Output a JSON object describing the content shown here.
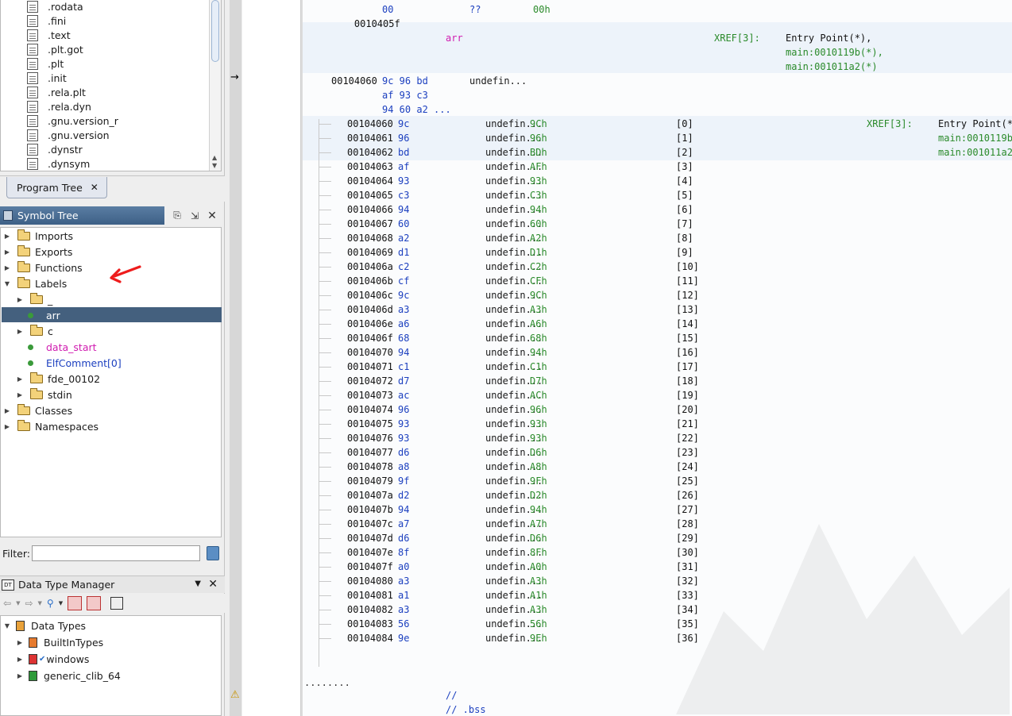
{
  "program_tree": {
    "items": [
      ".rodata",
      ".fini",
      ".text",
      ".plt.got",
      ".plt",
      ".init",
      ".rela.plt",
      ".rela.dyn",
      ".gnu.version_r",
      ".gnu.version",
      ".dynstr",
      ".dynsym"
    ],
    "tab_label": "Program Tree"
  },
  "symbol_tree": {
    "title": "Symbol Tree",
    "nodes": {
      "imports": "Imports",
      "exports": "Exports",
      "functions": "Functions",
      "labels": "Labels",
      "underscore": "_",
      "arr": "arr",
      "c": "c",
      "data_start": "data_start",
      "elfcomment": "ElfComment[0]",
      "fde": "fde_00102",
      "stdin": "stdin",
      "classes": "Classes",
      "namespaces": "Namespaces"
    },
    "filter_label": "Filter:",
    "filter_value": ""
  },
  "data_type_manager": {
    "title": "Data Type Manager",
    "root": "Data Types",
    "items": [
      "BuiltInTypes",
      "windows",
      "generic_clib_64"
    ]
  },
  "listing": {
    "top_line": {
      "addr": "0010405f",
      "bytes": "00",
      "mnem": "??",
      "val": "00h"
    },
    "label": "arr",
    "xref_label": "XREF[3]:",
    "xrefs": [
      "Entry Point(*),",
      "main:0010119b(*),",
      "main:001011a2(*)"
    ],
    "array_head": {
      "addr": "00104060",
      "bytes1": "9c 96 bd",
      "bytes2": "af 93 c3",
      "bytes3": "94 60 a2 ...",
      "mnem": "undefin..."
    },
    "first_elem_xref_label": "XREF[3]:",
    "first_elem_xrefs": [
      "Entry Point(*",
      "main:0010119b",
      "main:001011a2"
    ],
    "rows": [
      {
        "addr": "00104060",
        "b": "9c",
        "m": "undefin...",
        "v": "9Ch",
        "i": "[0]"
      },
      {
        "addr": "00104061",
        "b": "96",
        "m": "undefin...",
        "v": "96h",
        "i": "[1]"
      },
      {
        "addr": "00104062",
        "b": "bd",
        "m": "undefin...",
        "v": "BDh",
        "i": "[2]"
      },
      {
        "addr": "00104063",
        "b": "af",
        "m": "undefin...",
        "v": "AFh",
        "i": "[3]"
      },
      {
        "addr": "00104064",
        "b": "93",
        "m": "undefin...",
        "v": "93h",
        "i": "[4]"
      },
      {
        "addr": "00104065",
        "b": "c3",
        "m": "undefin...",
        "v": "C3h",
        "i": "[5]"
      },
      {
        "addr": "00104066",
        "b": "94",
        "m": "undefin...",
        "v": "94h",
        "i": "[6]"
      },
      {
        "addr": "00104067",
        "b": "60",
        "m": "undefin...",
        "v": "60h",
        "i": "[7]"
      },
      {
        "addr": "00104068",
        "b": "a2",
        "m": "undefin...",
        "v": "A2h",
        "i": "[8]"
      },
      {
        "addr": "00104069",
        "b": "d1",
        "m": "undefin...",
        "v": "D1h",
        "i": "[9]"
      },
      {
        "addr": "0010406a",
        "b": "c2",
        "m": "undefin...",
        "v": "C2h",
        "i": "[10]"
      },
      {
        "addr": "0010406b",
        "b": "cf",
        "m": "undefin...",
        "v": "CFh",
        "i": "[11]"
      },
      {
        "addr": "0010406c",
        "b": "9c",
        "m": "undefin...",
        "v": "9Ch",
        "i": "[12]"
      },
      {
        "addr": "0010406d",
        "b": "a3",
        "m": "undefin...",
        "v": "A3h",
        "i": "[13]"
      },
      {
        "addr": "0010406e",
        "b": "a6",
        "m": "undefin...",
        "v": "A6h",
        "i": "[14]"
      },
      {
        "addr": "0010406f",
        "b": "68",
        "m": "undefin...",
        "v": "68h",
        "i": "[15]"
      },
      {
        "addr": "00104070",
        "b": "94",
        "m": "undefin...",
        "v": "94h",
        "i": "[16]"
      },
      {
        "addr": "00104071",
        "b": "c1",
        "m": "undefin...",
        "v": "C1h",
        "i": "[17]"
      },
      {
        "addr": "00104072",
        "b": "d7",
        "m": "undefin...",
        "v": "D7h",
        "i": "[18]"
      },
      {
        "addr": "00104073",
        "b": "ac",
        "m": "undefin...",
        "v": "ACh",
        "i": "[19]"
      },
      {
        "addr": "00104074",
        "b": "96",
        "m": "undefin...",
        "v": "96h",
        "i": "[20]"
      },
      {
        "addr": "00104075",
        "b": "93",
        "m": "undefin...",
        "v": "93h",
        "i": "[21]"
      },
      {
        "addr": "00104076",
        "b": "93",
        "m": "undefin...",
        "v": "93h",
        "i": "[22]"
      },
      {
        "addr": "00104077",
        "b": "d6",
        "m": "undefin...",
        "v": "D6h",
        "i": "[23]"
      },
      {
        "addr": "00104078",
        "b": "a8",
        "m": "undefin...",
        "v": "A8h",
        "i": "[24]"
      },
      {
        "addr": "00104079",
        "b": "9f",
        "m": "undefin...",
        "v": "9Fh",
        "i": "[25]"
      },
      {
        "addr": "0010407a",
        "b": "d2",
        "m": "undefin...",
        "v": "D2h",
        "i": "[26]"
      },
      {
        "addr": "0010407b",
        "b": "94",
        "m": "undefin...",
        "v": "94h",
        "i": "[27]"
      },
      {
        "addr": "0010407c",
        "b": "a7",
        "m": "undefin...",
        "v": "A7h",
        "i": "[28]"
      },
      {
        "addr": "0010407d",
        "b": "d6",
        "m": "undefin...",
        "v": "D6h",
        "i": "[29]"
      },
      {
        "addr": "0010407e",
        "b": "8f",
        "m": "undefin...",
        "v": "8Fh",
        "i": "[30]"
      },
      {
        "addr": "0010407f",
        "b": "a0",
        "m": "undefin...",
        "v": "A0h",
        "i": "[31]"
      },
      {
        "addr": "00104080",
        "b": "a3",
        "m": "undefin...",
        "v": "A3h",
        "i": "[32]"
      },
      {
        "addr": "00104081",
        "b": "a1",
        "m": "undefin...",
        "v": "A1h",
        "i": "[33]"
      },
      {
        "addr": "00104082",
        "b": "a3",
        "m": "undefin...",
        "v": "A3h",
        "i": "[34]"
      },
      {
        "addr": "00104083",
        "b": "56",
        "m": "undefin...",
        "v": "56h",
        "i": "[35]"
      },
      {
        "addr": "00104084",
        "b": "9e",
        "m": "undefin...",
        "v": "9Eh",
        "i": "[36]"
      }
    ],
    "dots": "........",
    "comment1": "//",
    "comment2": "// .bss"
  },
  "colors": {
    "selection": "#44607e",
    "label": "#d01bb0",
    "bytes": "#1b3fbf",
    "value": "#2a8a2a"
  }
}
